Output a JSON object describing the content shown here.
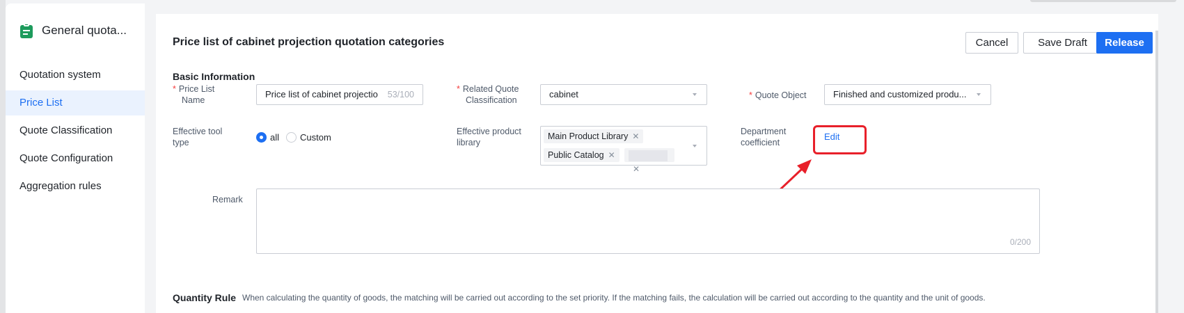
{
  "app": {
    "title": "General quota...",
    "icon": "clipboard-icon"
  },
  "sidebar": {
    "items": [
      {
        "label": "Quotation system",
        "active": false
      },
      {
        "label": "Price List",
        "active": true
      },
      {
        "label": "Quote Classification",
        "active": false
      },
      {
        "label": "Quote Configuration",
        "active": false
      },
      {
        "label": "Aggregation rules",
        "active": false
      }
    ]
  },
  "header": {
    "title": "Price list of cabinet projection quotation categories",
    "cancel_label": "Cancel",
    "save_draft_label": "Save Draft",
    "release_label": "Release"
  },
  "basic_info": {
    "section_title": "Basic Information",
    "required_mark": "*",
    "price_list_name": {
      "label_line1": "Price List",
      "label_line2": "Name",
      "value": "Price list of cabinet projectio",
      "count": "53/100"
    },
    "related_quote_classification": {
      "label_line1": "Related Quote",
      "label_line2": "Classification",
      "value": "cabinet"
    },
    "quote_object": {
      "label": "Quote Object",
      "value": "Finished and customized produ..."
    },
    "effective_tool_type": {
      "label_line1": "Effective tool",
      "label_line2": "type",
      "options": [
        "all",
        "Custom"
      ],
      "selected": "all"
    },
    "effective_product_library": {
      "label_line1": "Effective product",
      "label_line2": "library",
      "tags": [
        "Main Product Library",
        "Public Catalog"
      ]
    },
    "department_coefficient": {
      "label_line1": "Department",
      "label_line2": "coefficient",
      "edit_label": "Edit"
    },
    "remark": {
      "label": "Remark",
      "count": "0/200"
    }
  },
  "quantity_rule": {
    "title": "Quantity Rule",
    "description": "When calculating the quantity of goods, the matching will be carried out according to the set priority. If the matching fails, the calculation will be carried out according to the quantity and the unit of goods."
  },
  "colors": {
    "accent": "#1d6ff2",
    "brand_green": "#1d9b5c",
    "annotation_red": "#e8202a",
    "required_red": "#f53f3f"
  }
}
